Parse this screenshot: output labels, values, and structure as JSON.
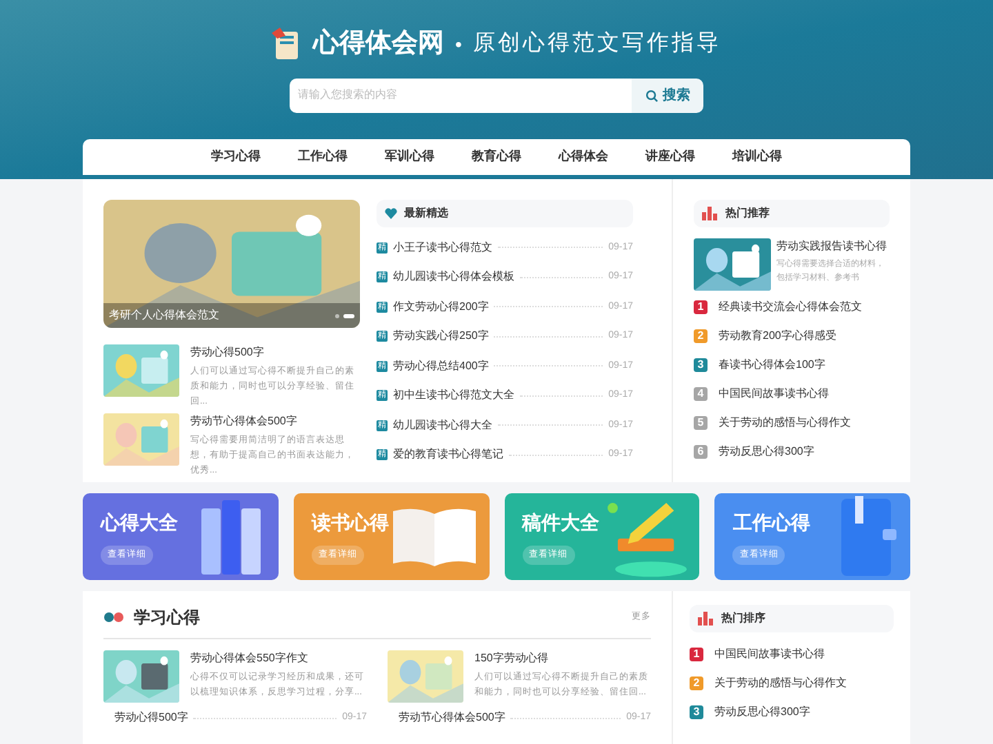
{
  "header": {
    "site_name": "心得体会网",
    "separator": "•",
    "slogan": "原创心得范文写作指导",
    "search": {
      "placeholder": "请输入您搜索的内容",
      "button": "搜索"
    }
  },
  "nav": [
    {
      "label": "学习心得"
    },
    {
      "label": "工作心得"
    },
    {
      "label": "军训心得"
    },
    {
      "label": "教育心得"
    },
    {
      "label": "心得体会"
    },
    {
      "label": "讲座心得"
    },
    {
      "label": "培训心得"
    }
  ],
  "carousel": {
    "caption": "考研个人心得体会范文",
    "dots": [
      {
        "selected": false
      },
      {
        "selected": true
      }
    ]
  },
  "featured": [
    {
      "title": "劳动心得500字",
      "summary": "人们可以通过写心得不断提升自己的素质和能力，同时也可以分享经验、留住回..."
    },
    {
      "title": "劳动节心得体会500字",
      "summary": "写心得需要用简洁明了的语言表达思想，有助于提高自己的书面表达能力，优秀..."
    }
  ],
  "latest": {
    "title": "最新精选",
    "items": [
      {
        "badge": "精",
        "title": "小王子读书心得范文",
        "date": "09-17"
      },
      {
        "badge": "精",
        "title": "幼儿园读书心得体会模板",
        "date": "09-17"
      },
      {
        "badge": "精",
        "title": "作文劳动心得200字",
        "date": "09-17"
      },
      {
        "badge": "精",
        "title": "劳动实践心得250字",
        "date": "09-17"
      },
      {
        "badge": "精",
        "title": "劳动心得总结400字",
        "date": "09-17"
      },
      {
        "badge": "精",
        "title": "初中生读书心得范文大全",
        "date": "09-17"
      },
      {
        "badge": "精",
        "title": "幼儿园读书心得大全",
        "date": "09-17"
      },
      {
        "badge": "精",
        "title": "爱的教育读书心得笔记",
        "date": "09-17"
      }
    ]
  },
  "hot": {
    "title": "热门推荐",
    "top": {
      "title": "劳动实践报告读书心得",
      "summary": "写心得需要选择合适的材料，包括学习材料、参考书"
    },
    "items": [
      {
        "rank": "1",
        "title": "经典读书交流会心得体会范文",
        "color": "#d9283e"
      },
      {
        "rank": "2",
        "title": "劳动教育200字心得感受",
        "color": "#f09a2a"
      },
      {
        "rank": "3",
        "title": "春读书心得体会100字",
        "color": "#1f8a9a"
      },
      {
        "rank": "4",
        "title": "中国民间故事读书心得",
        "color": "#a6a6a6"
      },
      {
        "rank": "5",
        "title": "关于劳动的感悟与心得作文",
        "color": "#a6a6a6"
      },
      {
        "rank": "6",
        "title": "劳动反思心得300字",
        "color": "#a6a6a6"
      }
    ]
  },
  "categories": [
    {
      "kind": "books",
      "title": "心得大全",
      "link": "查看详细",
      "color": "#6570e0"
    },
    {
      "kind": "open-book",
      "title": "读书心得",
      "link": "查看详细",
      "color": "#ec9a3c"
    },
    {
      "kind": "pencil",
      "title": "稿件大全",
      "link": "查看详细",
      "color": "#25b59a"
    },
    {
      "kind": "notebook",
      "title": "工作心得",
      "link": "查看详细",
      "color": "#4a8ef0"
    }
  ],
  "study": {
    "title": "学习心得",
    "more": "更多",
    "cards": [
      {
        "title": "劳动心得体会550字作文",
        "summary": "心得不仅可以记录学习经历和成果，还可以梳理知识体系，反思学习过程，分享..."
      },
      {
        "title": "150字劳动心得",
        "summary": "人们可以通过写心得不断提升自己的素质和能力，同时也可以分享经验、留住回..."
      }
    ],
    "items": [
      {
        "title": "劳动心得500字",
        "date": "09-17"
      },
      {
        "title": "劳动节心得体会500字",
        "date": "09-17"
      }
    ]
  },
  "ranking": {
    "title": "热门排序",
    "items": [
      {
        "rank": "1",
        "title": "中国民间故事读书心得",
        "color": "#d9283e"
      },
      {
        "rank": "2",
        "title": "关于劳动的感悟与心得作文",
        "color": "#f09a2a"
      },
      {
        "rank": "3",
        "title": "劳动反思心得300字",
        "color": "#1f8a9a"
      }
    ]
  }
}
